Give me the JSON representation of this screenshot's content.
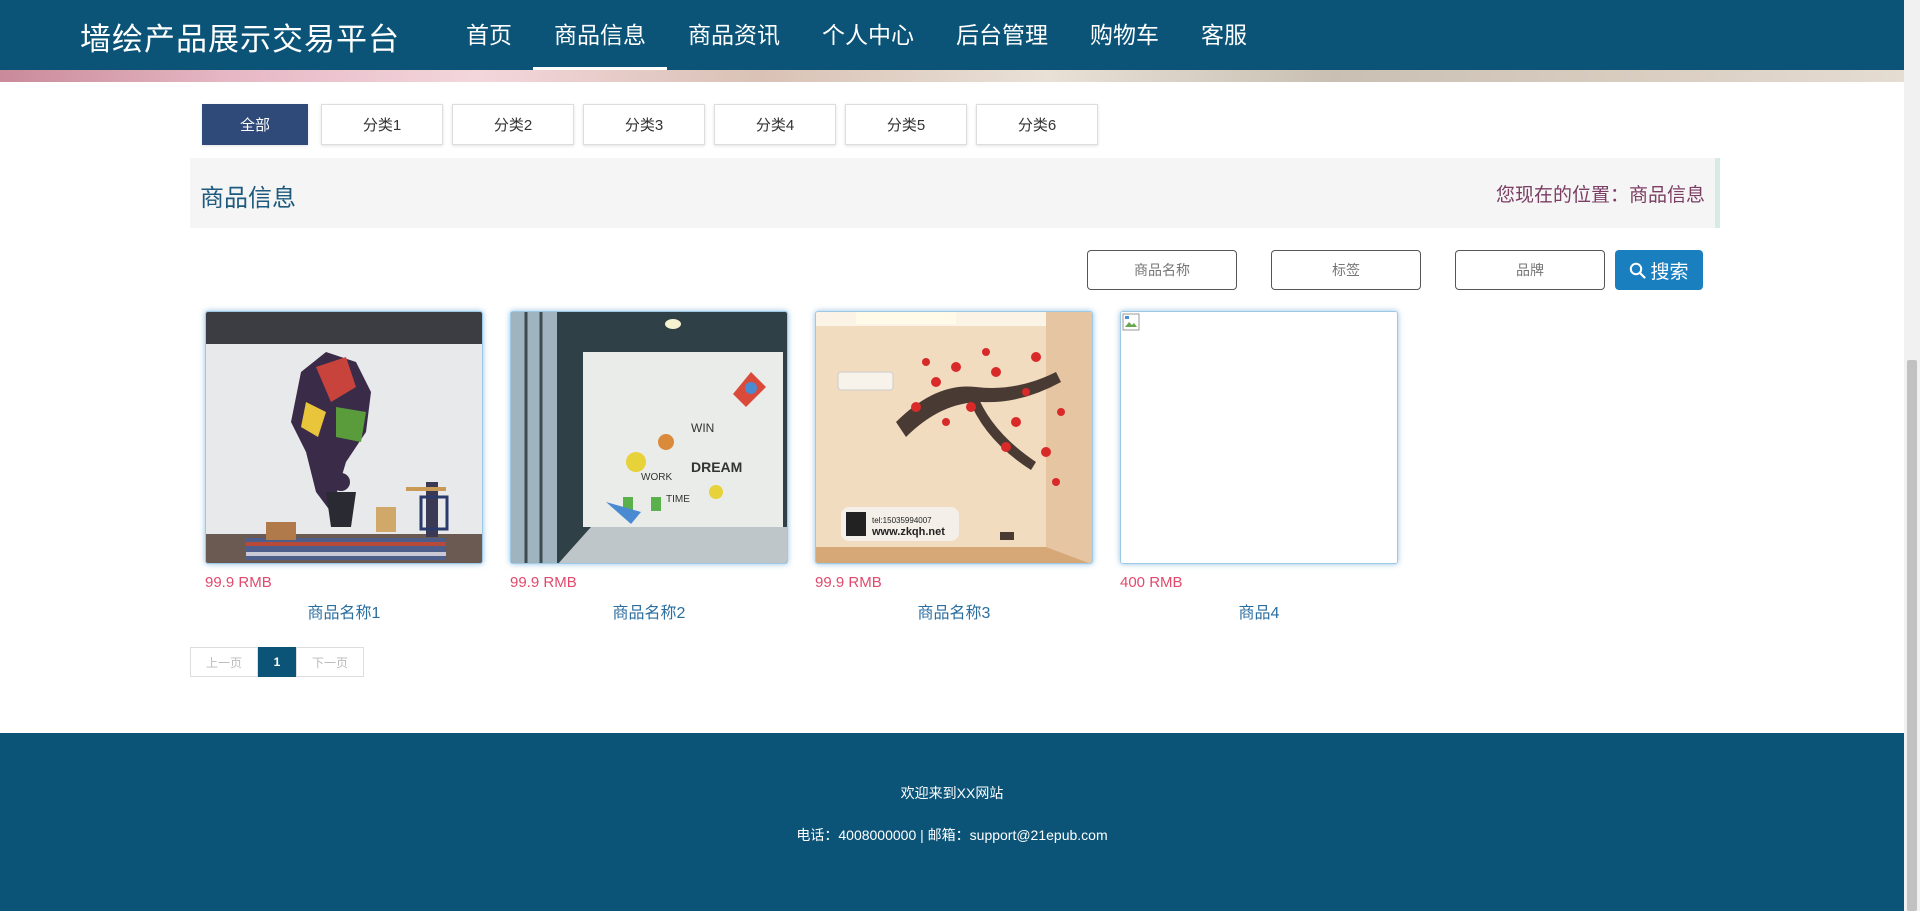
{
  "header": {
    "brand": "墙绘产品展示交易平台",
    "nav": [
      "首页",
      "商品信息",
      "商品资讯",
      "个人中心",
      "后台管理",
      "购物车",
      "客服"
    ],
    "active_index": 1
  },
  "categories": [
    "全部",
    "分类1",
    "分类2",
    "分类3",
    "分类4",
    "分类5",
    "分类6"
  ],
  "breadcrumb": {
    "title": "商品信息",
    "location": "您现在的位置：商品信息"
  },
  "search": {
    "name_placeholder": "商品名称",
    "tag_placeholder": "标签",
    "brand_placeholder": "品牌",
    "button_label": "搜索"
  },
  "products": [
    {
      "price": "99.9 RMB",
      "name": "商品名称1"
    },
    {
      "price": "99.9 RMB",
      "name": "商品名称2"
    },
    {
      "price": "99.9 RMB",
      "name": "商品名称3",
      "watermark_lines": [
        "tel:15035994007",
        "www.zkqh.net"
      ]
    },
    {
      "price": "400 RMB",
      "name": "商品4"
    }
  ],
  "pagination": {
    "prev": "上一页",
    "current": "1",
    "next": "下一页"
  },
  "footer": {
    "welcome": "欢迎来到XX网站",
    "contact": "电话：4008000000 | 邮箱：support@21epub.com"
  },
  "colors": {
    "header": "#0b5478",
    "category_active": "#2f4a78",
    "price": "#e04a6c",
    "search_button": "#1a7fbf"
  }
}
